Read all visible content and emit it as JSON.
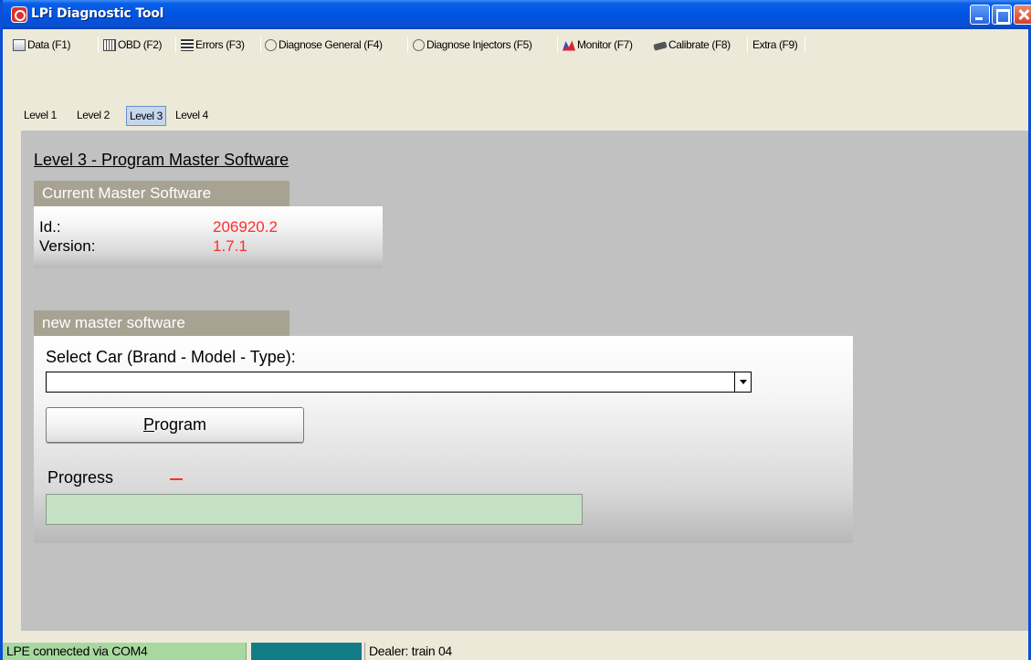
{
  "window": {
    "title": "LPi Diagnostic Tool"
  },
  "toolbar": {
    "tabs": [
      {
        "label": "Data (F1)",
        "icon": "data-icon"
      },
      {
        "label": "OBD (F2)",
        "icon": "obd-icon"
      },
      {
        "label": "Errors (F3)",
        "icon": "errors-icon"
      },
      {
        "label": "Diagnose General (F4)",
        "icon": "stethoscope-icon"
      },
      {
        "label": "Diagnose Injectors (F5)",
        "icon": "stethoscope-icon"
      },
      {
        "label": "Monitor (F7)",
        "icon": "monitor-chart-icon"
      },
      {
        "label": "Calibrate (F8)",
        "icon": "chip-icon"
      },
      {
        "label": "Extra (F9)",
        "icon": null
      }
    ],
    "active": "Calibrate (F8)"
  },
  "levels": {
    "tabs": [
      "Level 1",
      "Level 2",
      "Level 3",
      "Level 4"
    ],
    "active": "Level 3"
  },
  "main": {
    "heading": "Level 3 - Program Master Software",
    "current": {
      "title": "Current Master Software",
      "id_label": "Id.:",
      "id_value": "206920.2",
      "version_label": "Version:",
      "version_value": "1.7.1"
    },
    "new_software": {
      "title": "new master software",
      "select_label": "Select Car (Brand - Model - Type):",
      "select_value": "",
      "program_button": "Program",
      "program_button_mnemonic": "P",
      "program_button_rest": "rogram",
      "progress_label": "Progress",
      "progress_fraction": 0
    }
  },
  "status": {
    "connection": "LPE connected via COM4",
    "dealer": "Dealer: train 04"
  },
  "colors": {
    "title_bar": "#0054e3",
    "value_red": "#ff2d2d",
    "status_green": "#a8d8a0",
    "status_teal": "#127c86",
    "panel_grey": "#c1c1c1",
    "group_tab": "#a8a293",
    "progress_green": "#c5e0c5"
  }
}
